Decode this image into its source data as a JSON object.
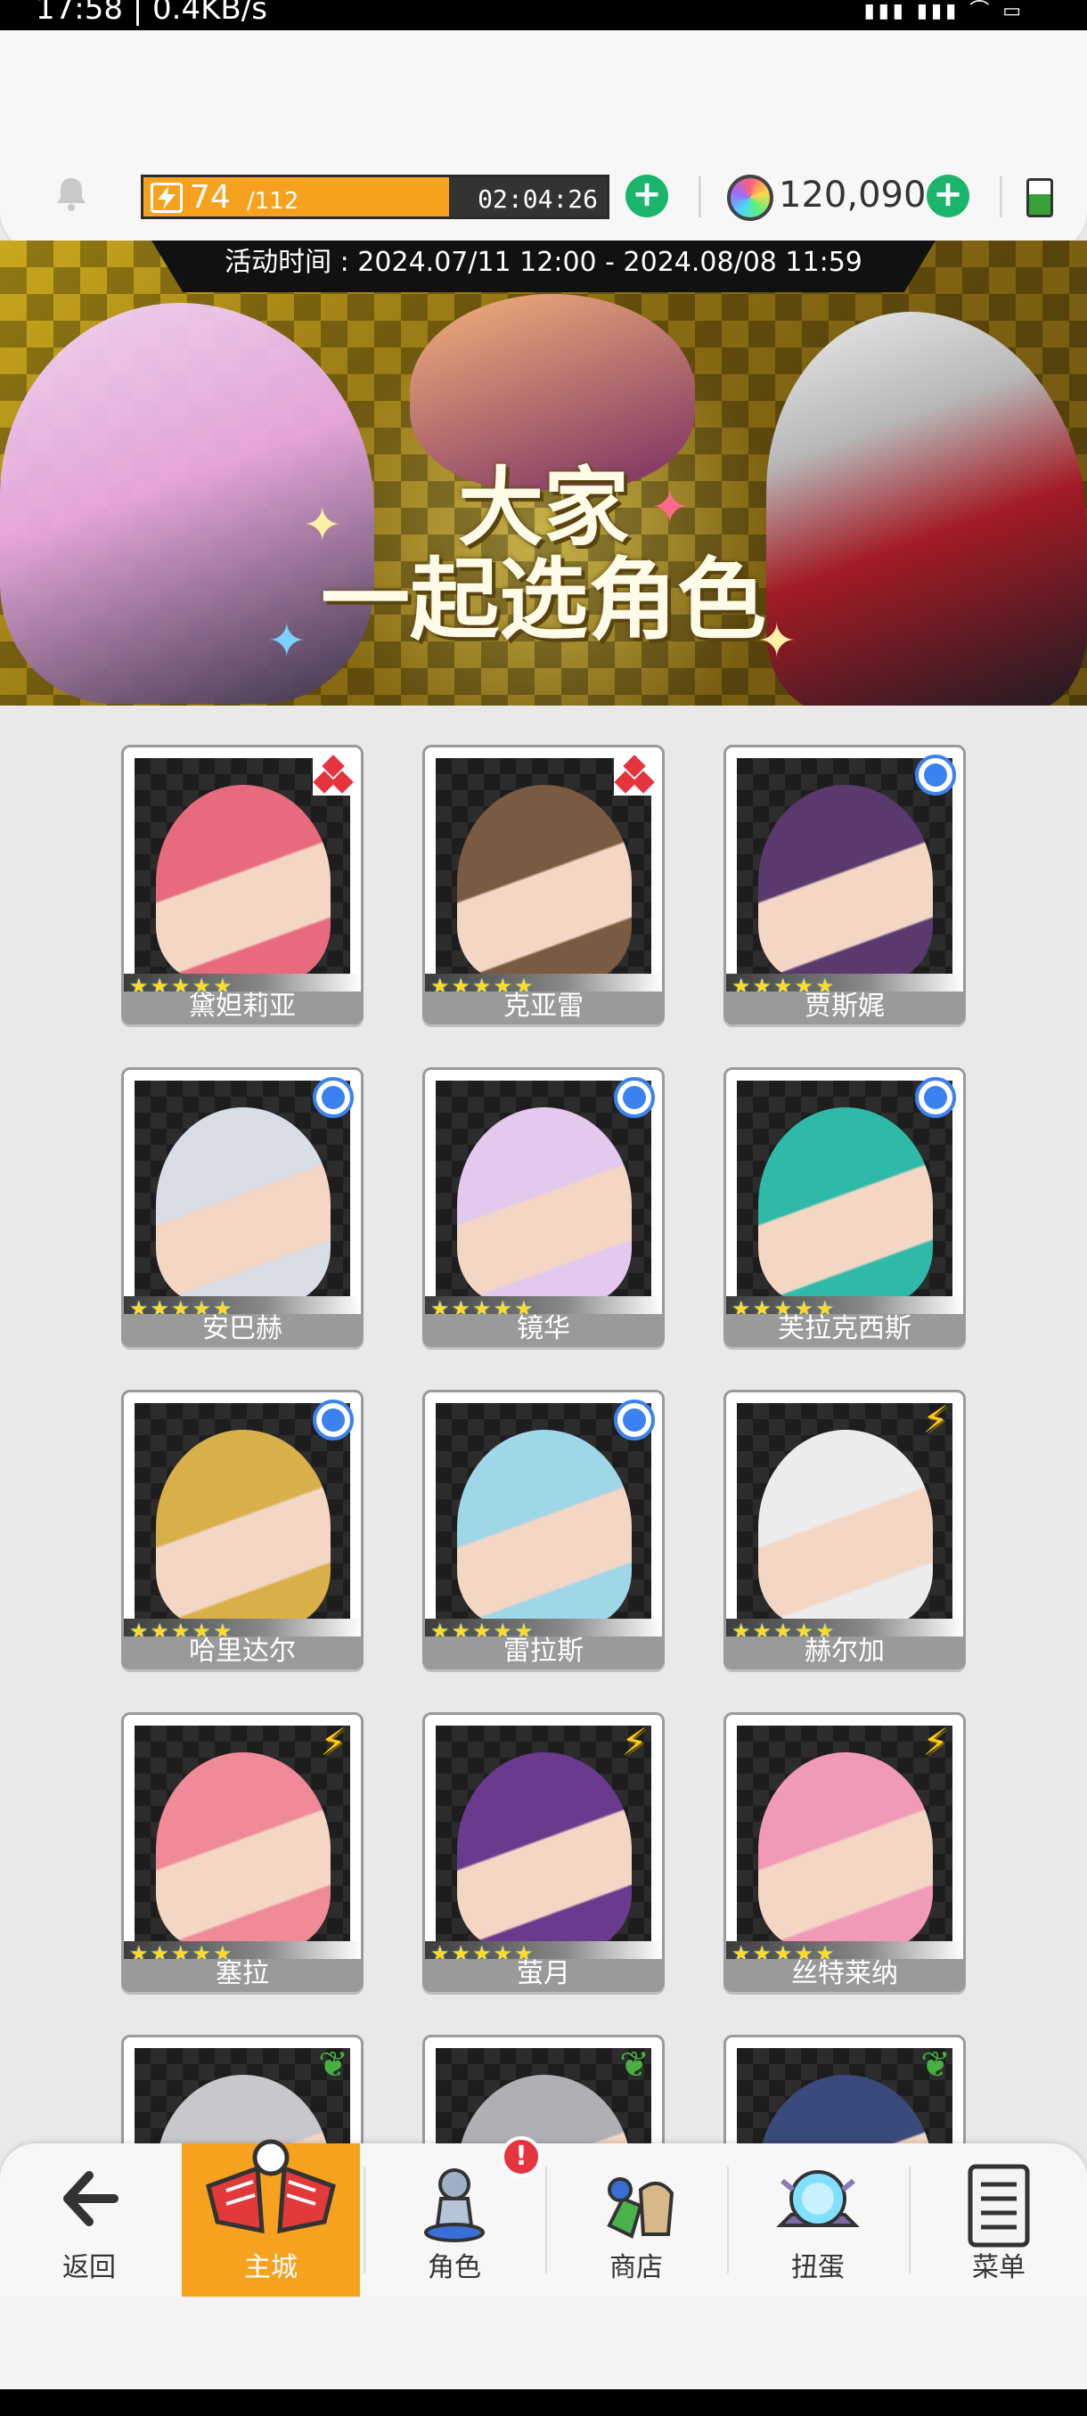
{
  "status_bar": {
    "time": "17:58 | 0.4KB/s",
    "right_icons": "▮▮▮ ▮▮▮ ⌒ ▭"
  },
  "header": {
    "stamina_current": "74",
    "stamina_max": "/112",
    "stamina_fraction": 0.66,
    "stamina_timer": "02:04:26",
    "gems": "120,090",
    "plus_label": "+"
  },
  "banner": {
    "event_time": "活动时间 : 2024.07/11 12:00 - 2024.08/08 11:59",
    "title_line1": "大家",
    "title_line2": "一起选角色"
  },
  "characters": [
    {
      "name": "黛妲莉亚",
      "attribute": "red-diamond-icon",
      "color": "#e86a7e"
    },
    {
      "name": "克亚雷",
      "attribute": "red-diamond-icon",
      "color": "#7a5a40"
    },
    {
      "name": "贾斯娓",
      "attribute": "blue-circle-icon",
      "color": "#5a3a6e"
    },
    {
      "name": "安巴赫",
      "attribute": "blue-circle-icon",
      "color": "#d9dde6"
    },
    {
      "name": "镜华",
      "attribute": "blue-circle-icon",
      "color": "#e4c9ef"
    },
    {
      "name": "芙拉克西斯",
      "attribute": "blue-circle-icon",
      "color": "#2fb9a8"
    },
    {
      "name": "哈里达尔",
      "attribute": "blue-circle-icon",
      "color": "#d8b04a"
    },
    {
      "name": "雷拉斯",
      "attribute": "blue-circle-icon",
      "color": "#9fd6e8"
    },
    {
      "name": "赫尔加",
      "attribute": "lightning-icon",
      "color": "#ececec"
    },
    {
      "name": "塞拉",
      "attribute": "lightning-icon",
      "color": "#f08a98"
    },
    {
      "name": "萤月",
      "attribute": "lightning-icon",
      "color": "#6a3a8e"
    },
    {
      "name": "丝特莱纳",
      "attribute": "lightning-icon",
      "color": "#f09ab8"
    },
    {
      "name": "",
      "attribute": "leaf-icon",
      "color": "#c8c8cc"
    },
    {
      "name": "",
      "attribute": "leaf-icon",
      "color": "#b0b0b4"
    },
    {
      "name": "",
      "attribute": "leaf-icon",
      "color": "#3a4a7a"
    }
  ],
  "stars": "★★★★★",
  "nav": [
    {
      "label": "返回",
      "icon": "back-arrow-icon"
    },
    {
      "label": "主城",
      "icon": "castle-icon",
      "active": true
    },
    {
      "label": "角色",
      "icon": "character-icon",
      "badge": "!"
    },
    {
      "label": "商店",
      "icon": "shop-icon"
    },
    {
      "label": "扭蛋",
      "icon": "gacha-icon"
    },
    {
      "label": "菜单",
      "icon": "menu-list-icon"
    }
  ],
  "colors": {
    "accent_orange": "#f7a21f",
    "plus_green": "#1ab56a",
    "badge_red": "#e5343e"
  }
}
